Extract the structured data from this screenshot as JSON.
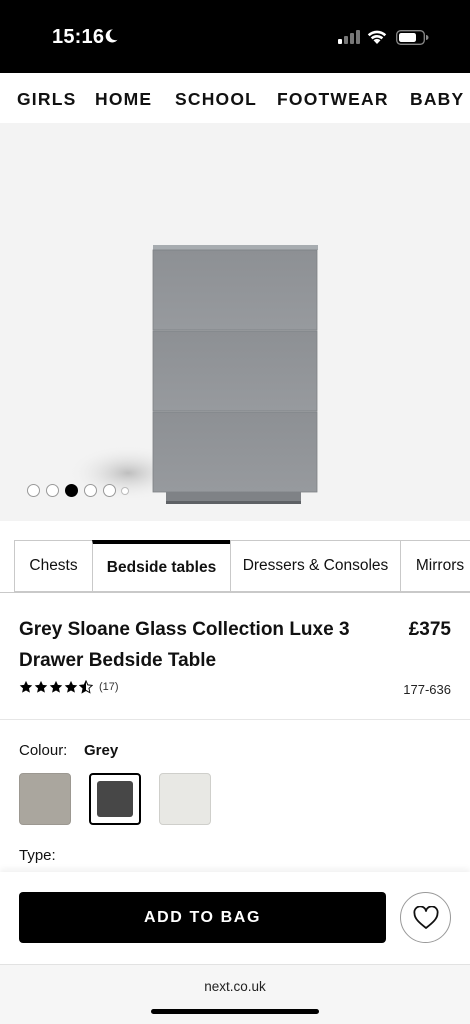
{
  "status_bar": {
    "time": "15:16",
    "icons": [
      "moon-icon",
      "cellular-signal-icon",
      "wifi-icon",
      "battery-icon"
    ]
  },
  "nav": {
    "items": [
      "GIRLS",
      "HOME",
      "SCHOOL",
      "FOOTWEAR",
      "BABY"
    ]
  },
  "hero": {
    "image": "grey-glass-3-drawer-bedside-table",
    "carousel": {
      "total_dots": 6,
      "active_index": 2
    }
  },
  "tabs": {
    "items": [
      "Chests",
      "Bedside tables",
      "Dressers & Consoles",
      "Mirrors"
    ],
    "active_index": 1
  },
  "product": {
    "title": "Grey Sloane Glass Collection Luxe 3 Drawer Bedside Table",
    "price": "£375",
    "rating": 4.5,
    "review_count": "(17)",
    "sku": "177-636"
  },
  "options": {
    "colour_label": "Colour:",
    "colour_value": "Grey",
    "swatches": [
      {
        "color": "#aaa69e",
        "selected": false
      },
      {
        "color": "#474747",
        "selected": true
      },
      {
        "color": "#e8e8e4",
        "selected": false
      }
    ],
    "type_label": "Type:"
  },
  "actions": {
    "add_to_bag": "ADD TO BAG",
    "favourite_icon": "heart-icon"
  },
  "browser": {
    "url": "next.co.uk"
  },
  "colors": {
    "primary": "#000000",
    "hero_bg": "#f3f3f3",
    "product_grey": "#8f9296"
  }
}
